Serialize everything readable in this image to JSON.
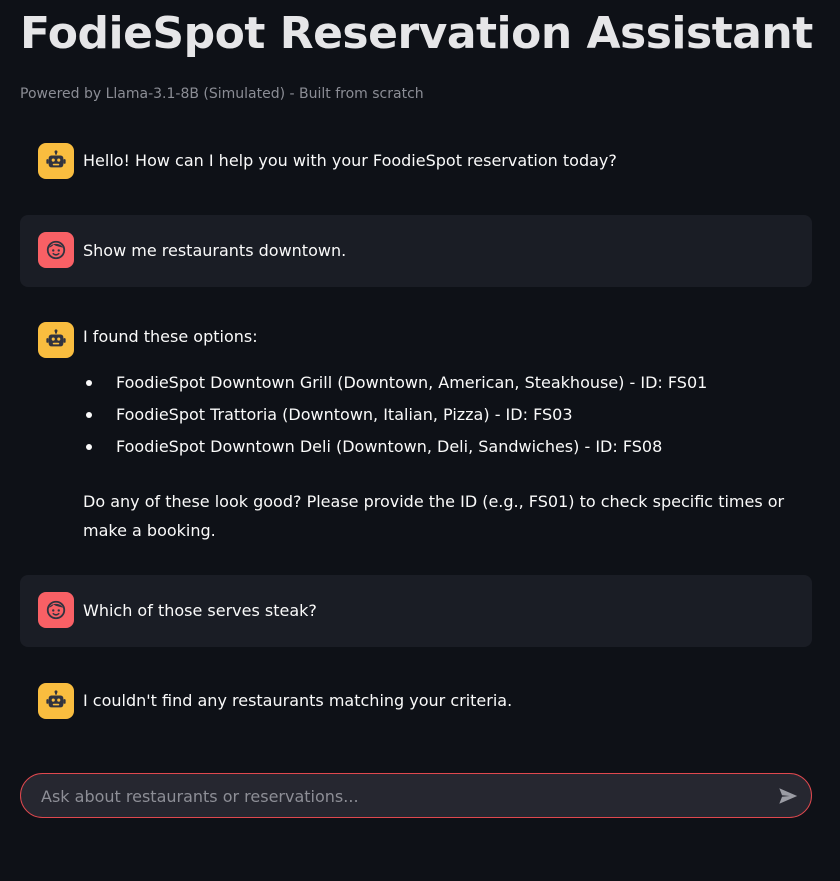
{
  "header": {
    "title": "FodieSpot Reservation Assistant",
    "subtitle": "Powered by Llama-3.1-8B (Simulated) - Built from scratch"
  },
  "messages": [
    {
      "role": "assistant",
      "icon": "robot-icon",
      "text": "Hello! How can I help you with your FoodieSpot reservation today?"
    },
    {
      "role": "user",
      "icon": "user-face-icon",
      "text": "Show me restaurants downtown."
    },
    {
      "role": "assistant",
      "icon": "robot-icon",
      "text": "I found these options:",
      "bullets": [
        "FoodieSpot Downtown Grill (Downtown, American, Steakhouse) - ID: FS01",
        "FoodieSpot Trattoria (Downtown, Italian, Pizza) - ID: FS03",
        "FoodieSpot Downtown Deli (Downtown, Deli, Sandwiches) - ID: FS08"
      ],
      "followup": "Do any of these look good? Please provide the ID (e.g., FS01) to check specific times or make a booking."
    },
    {
      "role": "user",
      "icon": "user-face-icon",
      "text": "Which of those serves steak?"
    },
    {
      "role": "assistant",
      "icon": "robot-icon",
      "text": "I couldn't find any restaurants matching your criteria."
    }
  ],
  "chat_input": {
    "placeholder": "Ask about restaurants or reservations...",
    "value": "",
    "send_icon": "send-icon"
  },
  "colors": {
    "background": "#0e1117",
    "user_message_bg": "#1a1d25",
    "bot_avatar": "#f9bd3f",
    "user_avatar": "#f96065",
    "input_border": "#e0484e"
  }
}
